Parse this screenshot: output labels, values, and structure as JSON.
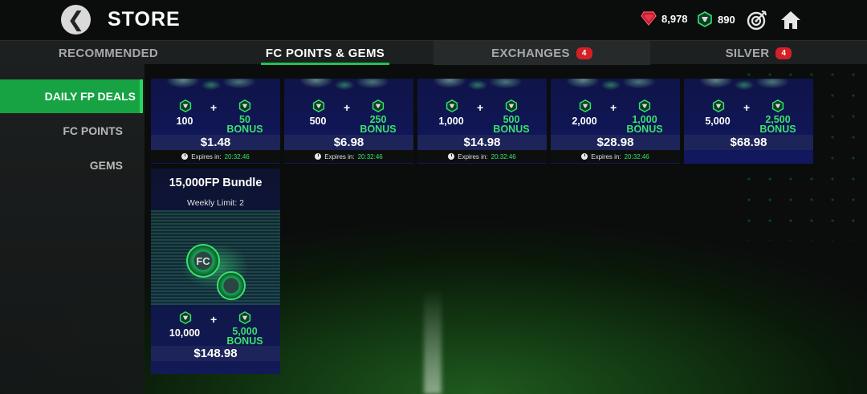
{
  "header": {
    "title": "STORE",
    "back_label": "❮",
    "currencies": {
      "gems": "8,978",
      "fc_points": "890"
    }
  },
  "tabs": [
    {
      "label": "RECOMMENDED",
      "badge": ""
    },
    {
      "label": "FC POINTS & GEMS",
      "badge": ""
    },
    {
      "label": "EXCHANGES",
      "badge": "4"
    },
    {
      "label": "SILVER",
      "badge": "4"
    }
  ],
  "sidebar": {
    "items": [
      {
        "label": "DAILY FP DEALS"
      },
      {
        "label": "FC POINTS"
      },
      {
        "label": "GEMS"
      }
    ]
  },
  "deals": [
    {
      "base": "100",
      "bonus": "50",
      "bonus_word": "BONUS",
      "price": "$1.48",
      "expires_label": "Expires in:",
      "expires_time": "20:32:46"
    },
    {
      "base": "500",
      "bonus": "250",
      "bonus_word": "BONUS",
      "price": "$6.98",
      "expires_label": "Expires in:",
      "expires_time": "20:32:46"
    },
    {
      "base": "1,000",
      "bonus": "500",
      "bonus_word": "BONUS",
      "price": "$14.98",
      "expires_label": "Expires in:",
      "expires_time": "20:32:46"
    },
    {
      "base": "2,000",
      "bonus": "1,000",
      "bonus_word": "BONUS",
      "price": "$28.98",
      "expires_label": "Expires in:",
      "expires_time": "20:32:46"
    },
    {
      "base": "5,000",
      "bonus": "2,500",
      "bonus_word": "BONUS",
      "price": "$68.98",
      "expires_label": "",
      "expires_time": ""
    }
  ],
  "bundle": {
    "title": "15,000FP Bundle",
    "limit": "Weekly Limit: 2",
    "base": "10,000",
    "bonus": "5,000",
    "bonus_word": "BONUS",
    "price": "$148.98",
    "coin_letters": "FC"
  },
  "plus_sign": "+",
  "colors": {
    "accent_green": "#1fc353",
    "bonus_green": "#38e26d",
    "badge_red": "#d32026",
    "card_navy": "#101654"
  },
  "icons": {
    "back": "chevron-left-icon",
    "gems": "red-gem-icon",
    "fc_points": "fc-point-coin-icon",
    "target": "target-icon",
    "home": "home-icon",
    "clock": "clock-icon"
  }
}
